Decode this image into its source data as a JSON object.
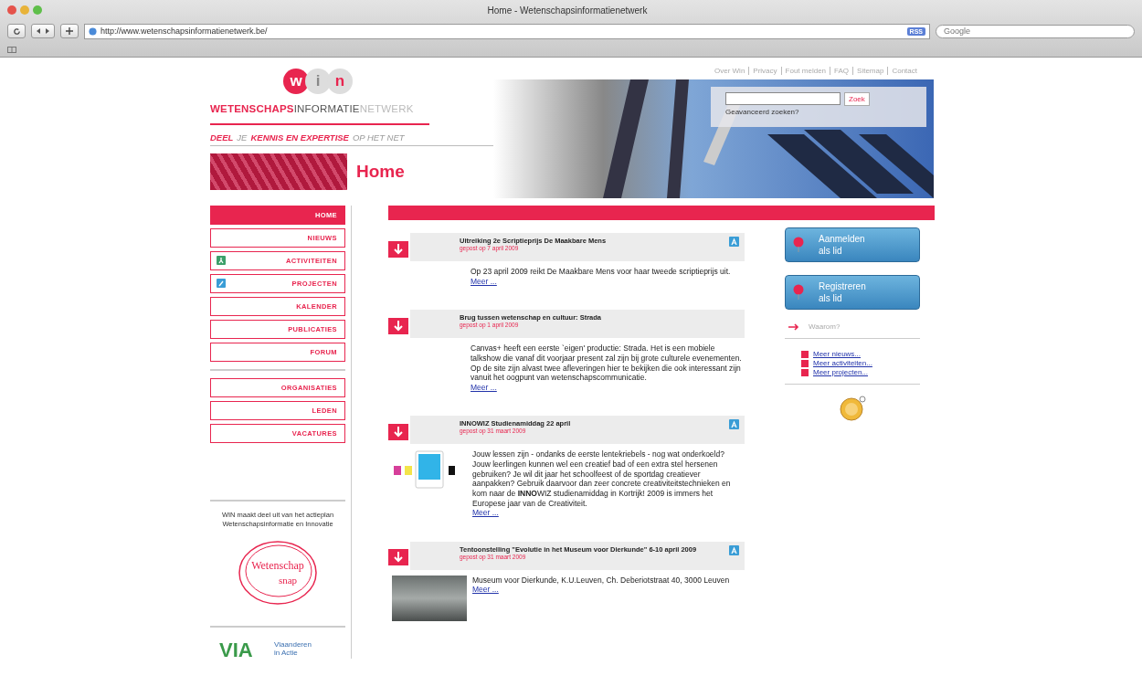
{
  "browser": {
    "title": "Home - Wetenschapsinformatienetwerk",
    "url": "http://www.wetenschapsinformatienetwerk.be/",
    "rss": "RSS",
    "search_placeholder": "Google"
  },
  "top_links": [
    "Over Win",
    "Privacy",
    "Fout melden",
    "FAQ",
    "Sitemap",
    "Contact"
  ],
  "logo": {
    "letters": [
      "w",
      "i",
      "n"
    ],
    "wordmark": [
      "WETENSCHAPS",
      "INFORMATIE",
      "NETWERK"
    ]
  },
  "tagline": [
    {
      "text": "DEEL",
      "emphasis": true
    },
    {
      "text": "JE",
      "emphasis": false
    },
    {
      "text": "KENNIS EN EXPERTISE",
      "emphasis": true
    },
    {
      "text": "OP HET NET",
      "emphasis": false
    }
  ],
  "page_title": "Home",
  "search": {
    "button": "Zoek",
    "advanced": "Geavanceerd zoeken?"
  },
  "nav": [
    [
      {
        "label": "HOME",
        "kind": "plain",
        "selected": true
      },
      {
        "label": "NIEUWS",
        "kind": "plain",
        "selected": false
      },
      {
        "label": "ACTIVITEITEN",
        "kind": "activity",
        "selected": false
      },
      {
        "label": "PROJECTEN",
        "kind": "project",
        "selected": false
      },
      {
        "label": "KALENDER",
        "kind": "plain",
        "selected": false
      },
      {
        "label": "PUBLICATIES",
        "kind": "plain",
        "selected": false
      },
      {
        "label": "FORUM",
        "kind": "plain",
        "selected": false
      }
    ],
    [
      {
        "label": "ORGANISATIES",
        "kind": "plain",
        "selected": false
      },
      {
        "label": "LEDEN",
        "kind": "plain",
        "selected": false
      },
      {
        "label": "VACATURES",
        "kind": "plain",
        "selected": false
      }
    ]
  ],
  "sidebar_note": "WIN maakt deel uit van het actieplan Wetenschapsinformatie en Innovatie",
  "stamp": [
    "Wetenschap",
    "snap"
  ],
  "via": {
    "letters": "VIA",
    "caption": [
      "Vlaanderen",
      "in Actie"
    ]
  },
  "articles": [
    {
      "title": "Uitreiking 2e Scriptieprijs De Maakbare Mens",
      "date": "gepost op 7 april 2009",
      "activity": true,
      "kind": "text",
      "body": "Op 23 april 2009 reikt De Maakbare Mens voor haar tweede scriptieprijs uit.",
      "more": "Meer ..."
    },
    {
      "title": "Brug tussen wetenschap en cultuur: Strada",
      "date": "gepost op 1 april 2009",
      "activity": false,
      "kind": "text",
      "body": "Canvas+ heeft een eerste `eigen' productie: Strada. Het is een mobiele talkshow die vanaf dit voorjaar present zal zijn bij grote culturele evenementen. Op de site zijn alvast twee afleveringen hier te bekijken die ook interessant zijn vanuit het oogpunt van wetenschapscommunicatie.",
      "more": "Meer ..."
    },
    {
      "title": "INNOWIZ Studienamiddag 22 april",
      "date": "gepost op 31 maart 2009",
      "activity": true,
      "kind": "colors",
      "body": "Jouw lessen zijn - ondanks de eerste lentekriebels - nog wat onderkoeld? Jouw leerlingen kunnen wel een creatief bad of een extra stel hersenen gebruiken? Je wil dit jaar het schoolfeest of de sportdag creatiever aanpakken? Gebruik daarvoor dan zeer concrete creativiteitstechnieken en kom naar de **INNO**WIZ studienamiddag in Kortrijk! 2009 is immers het Europese jaar van de Creativiteit.",
      "more": "Meer ..."
    },
    {
      "title": "Tentoonstelling \"Evolutie in het Museum voor Dierkunde\" 6-10 april 2009",
      "date": "gepost op 31 maart 2009",
      "activity": true,
      "kind": "photo",
      "body": "Museum voor Dierkunde, K.U.Leuven, Ch. Deberiotstraat 40, 3000 Leuven",
      "more": "Meer ..."
    }
  ],
  "member_buttons": [
    {
      "lines": [
        "Aanmelden",
        "als lid"
      ]
    },
    {
      "lines": [
        "Registreren",
        "als lid"
      ]
    }
  ],
  "why": "Waarom?",
  "more_links": [
    "Meer nieuws...",
    "Meer activiteiten...",
    "Meer projecten..."
  ]
}
